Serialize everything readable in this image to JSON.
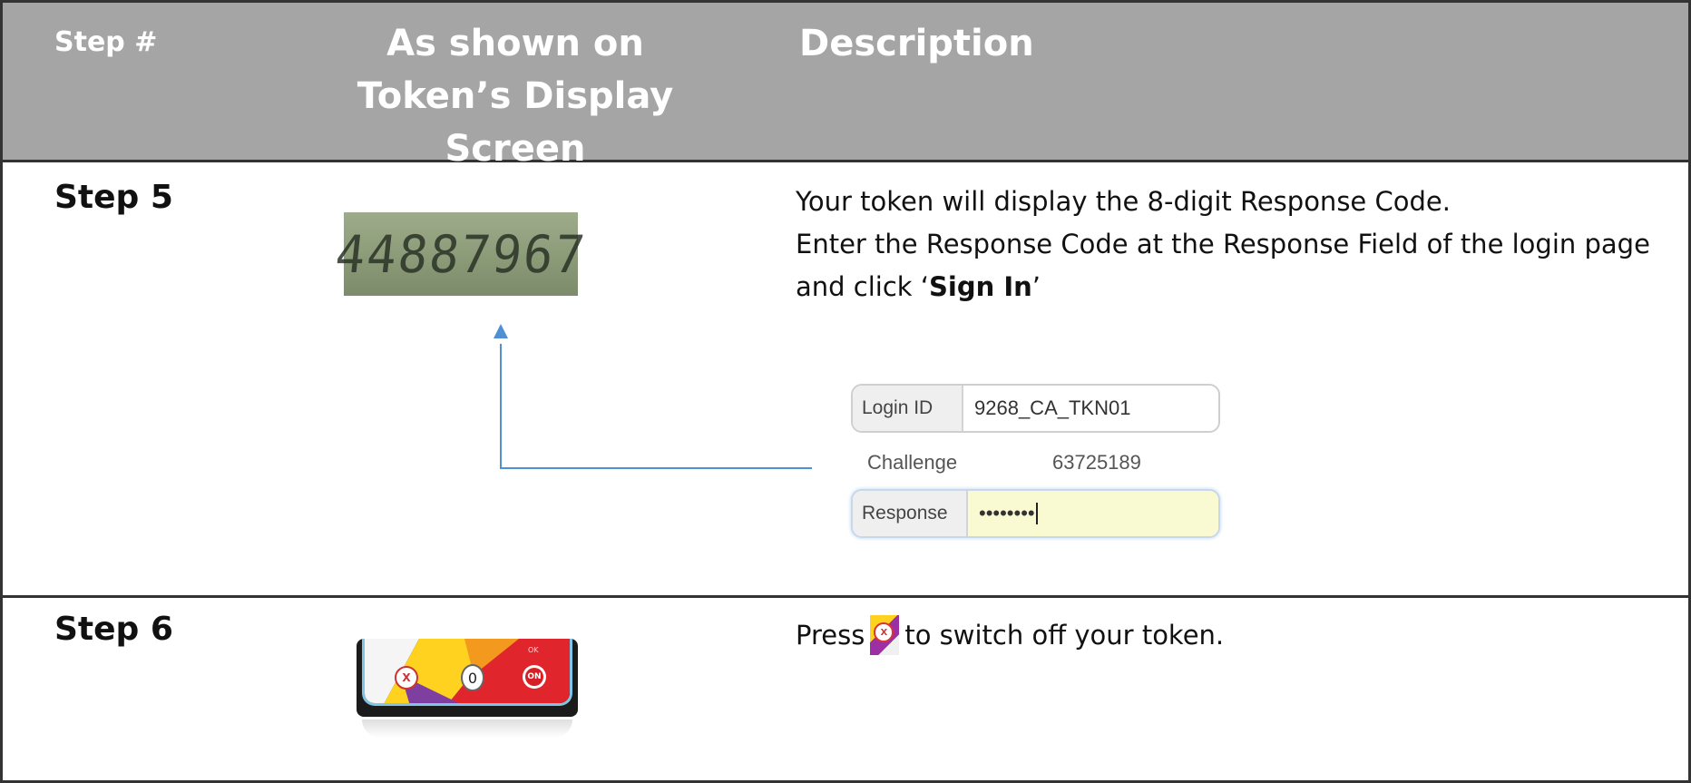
{
  "header": {
    "step_col": "Step #",
    "token_col": "As shown on Token’s Display Screen",
    "desc_col": "Description"
  },
  "rows": [
    {
      "step": "Step 5",
      "lcd_value": "44887967",
      "desc_line1": "Your token will display the 8-digit Response Code.",
      "desc_line2_pre": "Enter the Response Code at the Response Field of the login page and click ‘",
      "desc_bold": "Sign In",
      "desc_line2_post": "’",
      "form": {
        "login_label": "Login ID",
        "login_value": "9268_CA_TKN01",
        "challenge_label": "Challenge",
        "challenge_value": "63725189",
        "response_label": "Response",
        "response_value": "••••••••"
      }
    },
    {
      "step": "Step 6",
      "keys": {
        "x": "X",
        "zero": "0",
        "on": "ON",
        "ok": "OK"
      },
      "desc_pre": "Press",
      "desc_post": "to switch off your token.",
      "inline_icon": "x-key-icon"
    }
  ],
  "colors": {
    "header_bg": "#a5a5a5",
    "arrow": "#4f8fd3",
    "response_field_bg": "#fafad2"
  }
}
